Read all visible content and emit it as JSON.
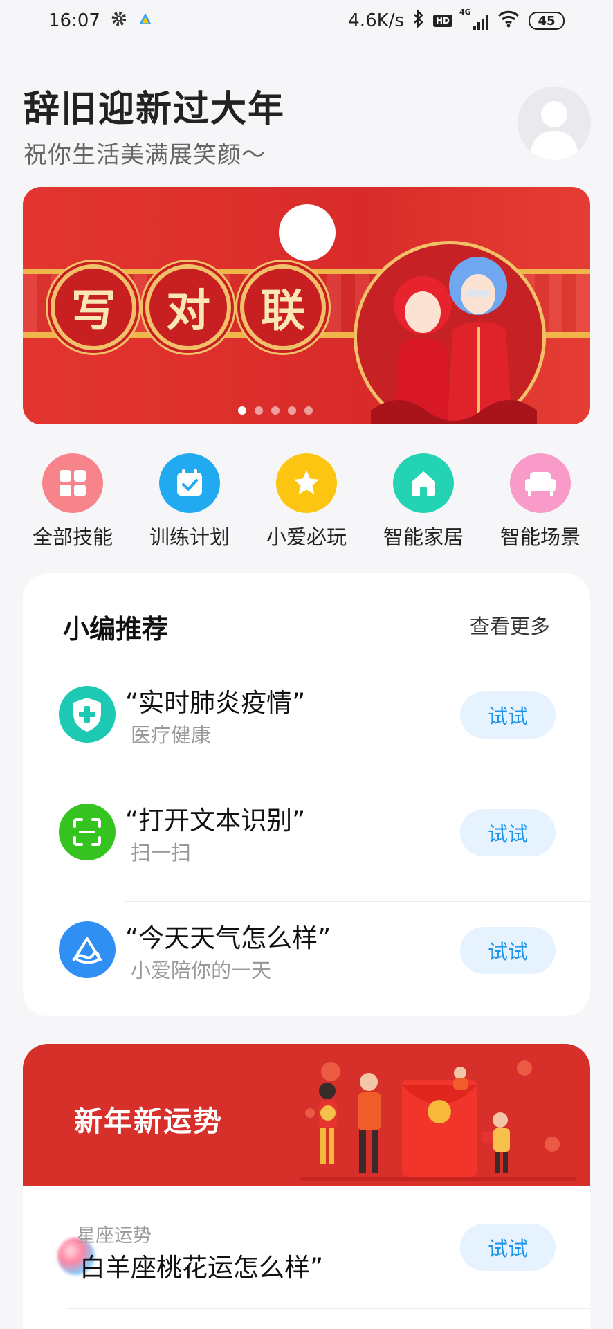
{
  "status_bar": {
    "time": "16:07",
    "net_speed": "4.6K/s",
    "hd": "HD",
    "network": "4G",
    "battery": "45",
    "icons": [
      "settings-gear-icon",
      "app-notification-icon",
      "bluetooth-icon",
      "signal-icon",
      "wifi-icon",
      "battery-icon"
    ]
  },
  "header": {
    "title": "辞旧迎新过大年",
    "subtitle": "祝你生活美满展笑颜～"
  },
  "banner": {
    "characters": [
      "写",
      "对",
      "联"
    ],
    "colors": {
      "background": "#e23530",
      "gold": "#f2c068"
    },
    "dots_total": 5,
    "active_dot": 1
  },
  "shortcuts": [
    {
      "label": "全部技能",
      "icon": "grid-icon",
      "color": "#f7848a"
    },
    {
      "label": "训练计划",
      "icon": "calendar-check-icon",
      "color": "#22aaf0"
    },
    {
      "label": "小爱必玩",
      "icon": "star-icon",
      "color": "#fcc512"
    },
    {
      "label": "智能家居",
      "icon": "home-icon",
      "color": "#23d3b3"
    },
    {
      "label": "智能场景",
      "icon": "sofa-icon",
      "color": "#f99bc8"
    }
  ],
  "recommend": {
    "title": "小编推荐",
    "more_label": "查看更多",
    "items": [
      {
        "query": "“实时肺炎疫情”",
        "category": "医疗健康",
        "button": "试试",
        "icon": "medical-shield-icon",
        "color": "#1dc9b2"
      },
      {
        "query": "“打开文本识别”",
        "category": "扫一扫",
        "button": "试试",
        "icon": "scan-icon",
        "color": "#36c31f"
      },
      {
        "query": "“今天天气怎么样”",
        "category": "小爱陪你的一天",
        "button": "试试",
        "icon": "xiaoai-logo-icon",
        "color": "#2f8ff2"
      }
    ]
  },
  "new_year": {
    "title": "新年新运势",
    "item": {
      "category": "星座运势",
      "query": "白羊座桃花运怎么样”",
      "button": "试试"
    },
    "colors": {
      "header": "#d72f29"
    }
  },
  "colors": {
    "accent": "#2196e8",
    "button_bg": "#e6f2fd",
    "page_bg": "#f6f6f8"
  }
}
